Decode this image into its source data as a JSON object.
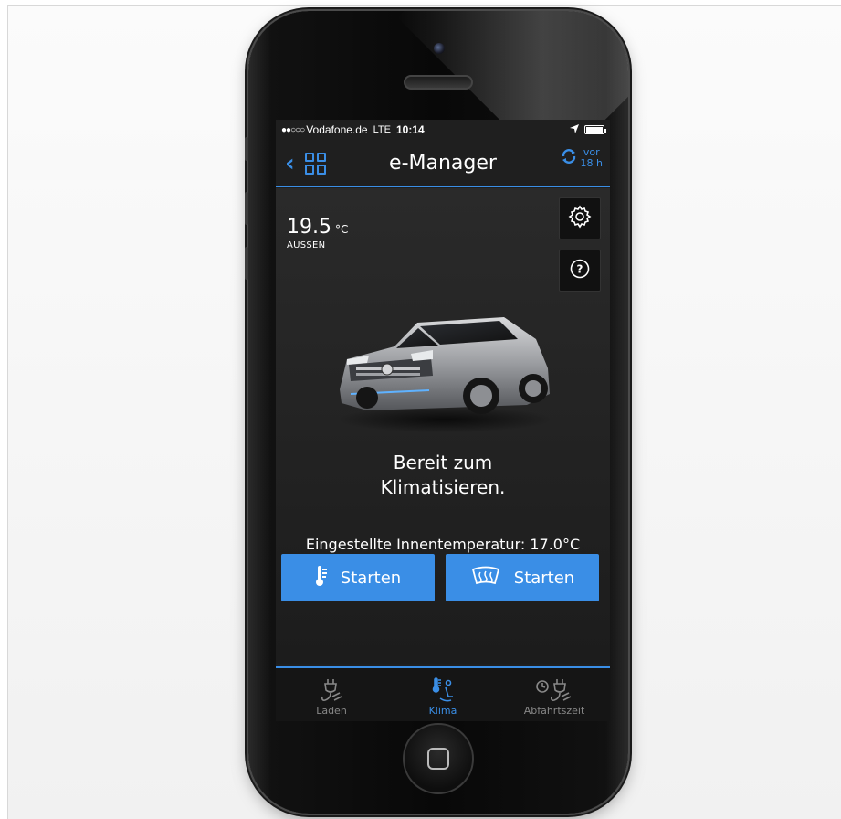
{
  "status_bar": {
    "signal": "●●○○○",
    "carrier": "Vodafone.de",
    "network": "LTE",
    "time": "10:14",
    "battery_level": 1.0
  },
  "nav": {
    "title": "e-Manager",
    "refresh_ago_line1": "vor",
    "refresh_ago_line2": "18 h"
  },
  "outside_temp": {
    "value": "19.5",
    "unit": "°C",
    "label": "AUSSEN"
  },
  "status_message_line1": "Bereit zum",
  "status_message_line2": "Klimatisieren.",
  "inner_temperature": "Eingestellte Innentemperatur: 17.0°C",
  "buttons": {
    "start_heating": "Starten",
    "start_defrost": "Starten"
  },
  "tabs": [
    {
      "label": "Laden",
      "active": false
    },
    {
      "label": "Klima",
      "active": true
    },
    {
      "label": "Abfahrtszeit",
      "active": false
    }
  ],
  "colors": {
    "accent": "#3a8ee6",
    "background": "#1f1f1f",
    "inactive_tab": "#888888"
  }
}
